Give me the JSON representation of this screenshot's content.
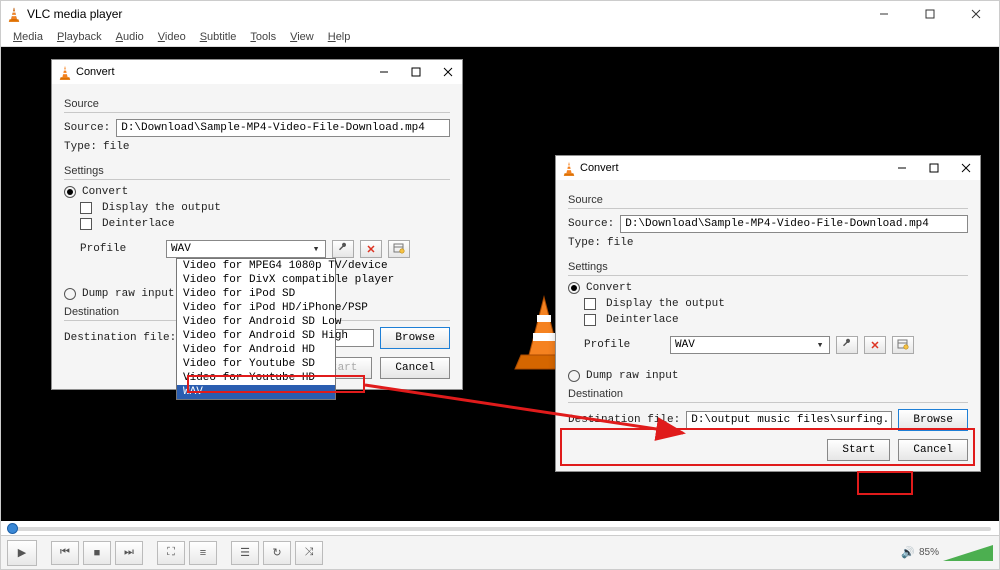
{
  "app": {
    "title": "VLC media player",
    "menus": [
      "Media",
      "Playback",
      "Audio",
      "Video",
      "Subtitle",
      "Tools",
      "View",
      "Help"
    ]
  },
  "volume_pct": "85%",
  "dialog1": {
    "title": "Convert",
    "group_source": "Source",
    "source_label": "Source:",
    "source_value": "D:\\Download\\Sample-MP4-Video-File-Download.mp4",
    "type_label": "Type:",
    "type_value": "file",
    "group_settings": "Settings",
    "convert_label": "Convert",
    "display_output": "Display the output",
    "deinterlace": "Deinterlace",
    "profile_label": "Profile",
    "profile_value": "WAV",
    "dump_raw": "Dump raw input",
    "group_dest": "Destination",
    "dest_label": "Destination file:",
    "dest_value": "",
    "browse": "Browse",
    "start": "Start",
    "cancel": "Cancel",
    "options": [
      "Video for MPEG4 1080p TV/device",
      "Video for DivX compatible player",
      "Video for iPod SD",
      "Video for iPod HD/iPhone/PSP",
      "Video for Android SD Low",
      "Video for Android SD High",
      "Video for Android HD",
      "Video for Youtube SD",
      "Video for Youtube HD",
      "WAV"
    ]
  },
  "dialog2": {
    "title": "Convert",
    "group_source": "Source",
    "source_label": "Source:",
    "source_value": "D:\\Download\\Sample-MP4-Video-File-Download.mp4",
    "type_label": "Type:",
    "type_value": "file",
    "group_settings": "Settings",
    "convert_label": "Convert",
    "display_output": "Display the output",
    "deinterlace": "Deinterlace",
    "profile_label": "Profile",
    "profile_value": "WAV",
    "dump_raw": "Dump raw input",
    "group_dest": "Destination",
    "dest_label": "Destination file:",
    "dest_value": "D:\\output music files\\surfing.wav",
    "browse": "Browse",
    "start": "Start",
    "cancel": "Cancel"
  }
}
